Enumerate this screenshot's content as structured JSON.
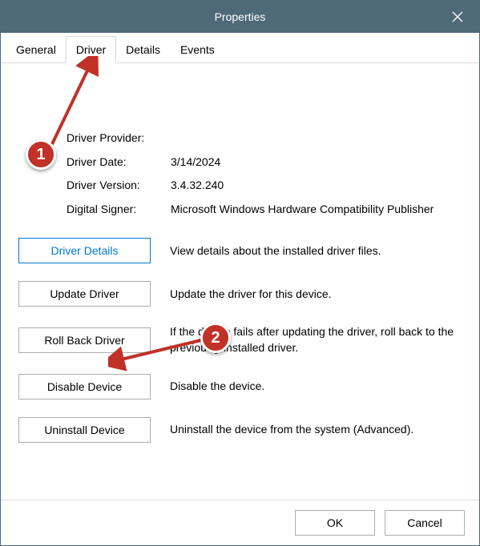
{
  "window": {
    "title": "Properties"
  },
  "tabs": {
    "general": "General",
    "driver": "Driver",
    "details": "Details",
    "events": "Events",
    "active": "Driver"
  },
  "driver_info": {
    "provider_label": "Driver Provider:",
    "provider_value": "",
    "date_label": "Driver Date:",
    "date_value": "3/14/2024",
    "version_label": "Driver Version:",
    "version_value": "3.4.32.240",
    "signer_label": "Digital Signer:",
    "signer_value": "Microsoft Windows Hardware Compatibility Publisher"
  },
  "buttons": {
    "driver_details": {
      "label": "Driver Details",
      "desc": "View details about the installed driver files."
    },
    "update_driver": {
      "label": "Update Driver",
      "desc": "Update the driver for this device."
    },
    "roll_back_driver": {
      "label": "Roll Back Driver",
      "desc": "If the device fails after updating the driver, roll back to the previously installed driver."
    },
    "disable_device": {
      "label": "Disable Device",
      "desc": "Disable the device."
    },
    "uninstall_device": {
      "label": "Uninstall Device",
      "desc": "Uninstall the device from the system (Advanced)."
    }
  },
  "footer": {
    "ok": "OK",
    "cancel": "Cancel"
  },
  "annotations": {
    "mark1": "1",
    "mark2": "2"
  }
}
